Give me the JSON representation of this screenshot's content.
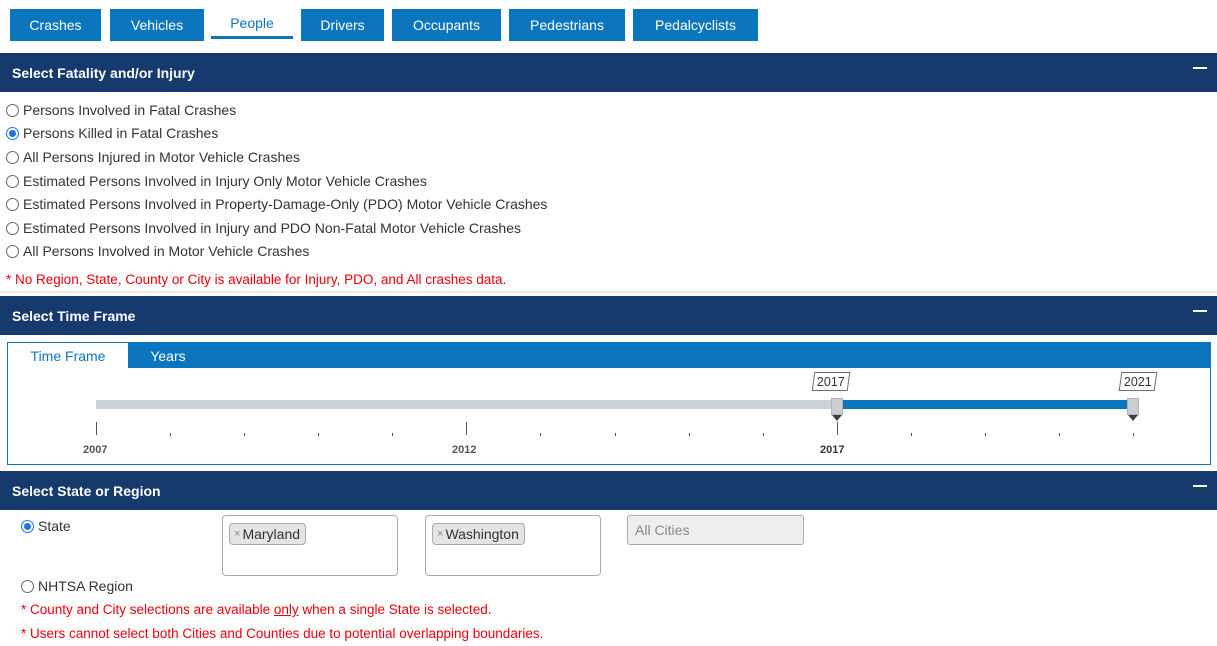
{
  "tabs": [
    {
      "label": "Crashes",
      "active": false
    },
    {
      "label": "Vehicles",
      "active": false
    },
    {
      "label": "People",
      "active": true
    },
    {
      "label": "Drivers",
      "active": false
    },
    {
      "label": "Occupants",
      "active": false
    },
    {
      "label": "Pedestrians",
      "active": false
    },
    {
      "label": "Pedalcyclists",
      "active": false
    }
  ],
  "fatality": {
    "title": "Select Fatality and/or Injury",
    "options": [
      {
        "label": "Persons Involved in Fatal Crashes",
        "checked": false
      },
      {
        "label": "Persons Killed in Fatal Crashes",
        "checked": true
      },
      {
        "label": "All Persons Injured in Motor Vehicle Crashes",
        "checked": false
      },
      {
        "label": "Estimated Persons Involved in Injury Only Motor Vehicle Crashes",
        "checked": false
      },
      {
        "label": "Estimated Persons Involved in Property-Damage-Only (PDO) Motor Vehicle Crashes",
        "checked": false
      },
      {
        "label": "Estimated Persons Involved in Injury and PDO Non-Fatal Motor Vehicle Crashes",
        "checked": false
      },
      {
        "label": "All Persons Involved in Motor Vehicle Crashes",
        "checked": false
      }
    ],
    "note": "* No Region, State, County or City is available for Injury, PDO, and All crashes data."
  },
  "timeframe": {
    "title": "Select Time Frame",
    "tabs": [
      {
        "label": "Time Frame",
        "active": true
      },
      {
        "label": "Years",
        "active": false
      }
    ],
    "slider": {
      "min": 2007,
      "max": 2021,
      "from": 2017,
      "to": 2021,
      "from_label": "2017",
      "to_label": "2021",
      "tick_labels": [
        "2007",
        "2012",
        "2017"
      ]
    }
  },
  "region": {
    "title": "Select State or Region",
    "state_option": {
      "label": "State",
      "checked": true
    },
    "nhtsa_option": {
      "label": "NHTSA Region",
      "checked": false
    },
    "state_chip": "Maryland",
    "county_chip": "Washington",
    "cities_placeholder": "All Cities",
    "chip_remove": "×",
    "note1_pre": "* County and City selections are available ",
    "note1_only": "only",
    "note1_post": " when a single State is selected.",
    "note2": "* Users cannot select both Cities and Counties due to potential overlapping boundaries."
  },
  "colors": {
    "tab_blue": "#0b75bd",
    "header_navy": "#163a6e",
    "note_red": "#e8000b",
    "radio_blue": "#1a73e8"
  }
}
